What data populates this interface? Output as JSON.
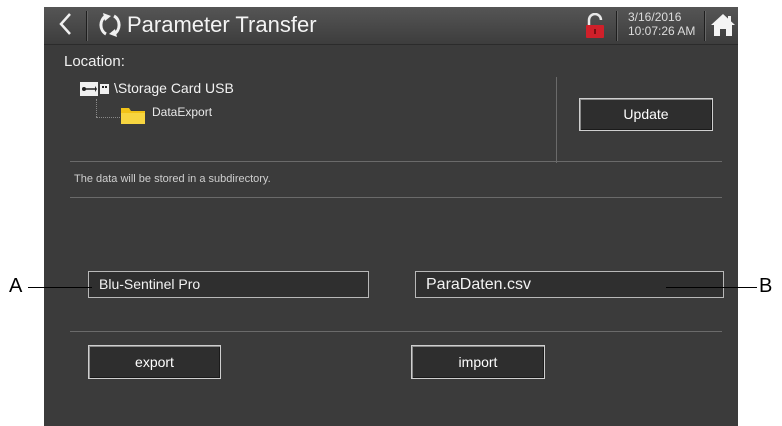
{
  "window": {
    "title": "Parameter Transfer",
    "date": "3/16/2016",
    "time": "10:07:26 AM",
    "icons": [
      "back-arrow-icon",
      "transfer-refresh-icon",
      "lock-icon",
      "home-icon"
    ]
  },
  "location": {
    "label": "Location:",
    "storage": "\\Storage Card USB",
    "folder": "DataExport"
  },
  "buttons": {
    "update": "Update",
    "export": "export",
    "import": "import"
  },
  "note": "The data will be stored in a subdirectory.",
  "fields": {
    "device_name": "Blu-Sentinel Pro",
    "file_name": "ParaDaten.csv"
  },
  "callouts": {
    "a": "A",
    "b": "B"
  },
  "colors": {
    "panel": "#3b3b3b",
    "lock": "#d0202a",
    "folder": "#f2c318"
  }
}
